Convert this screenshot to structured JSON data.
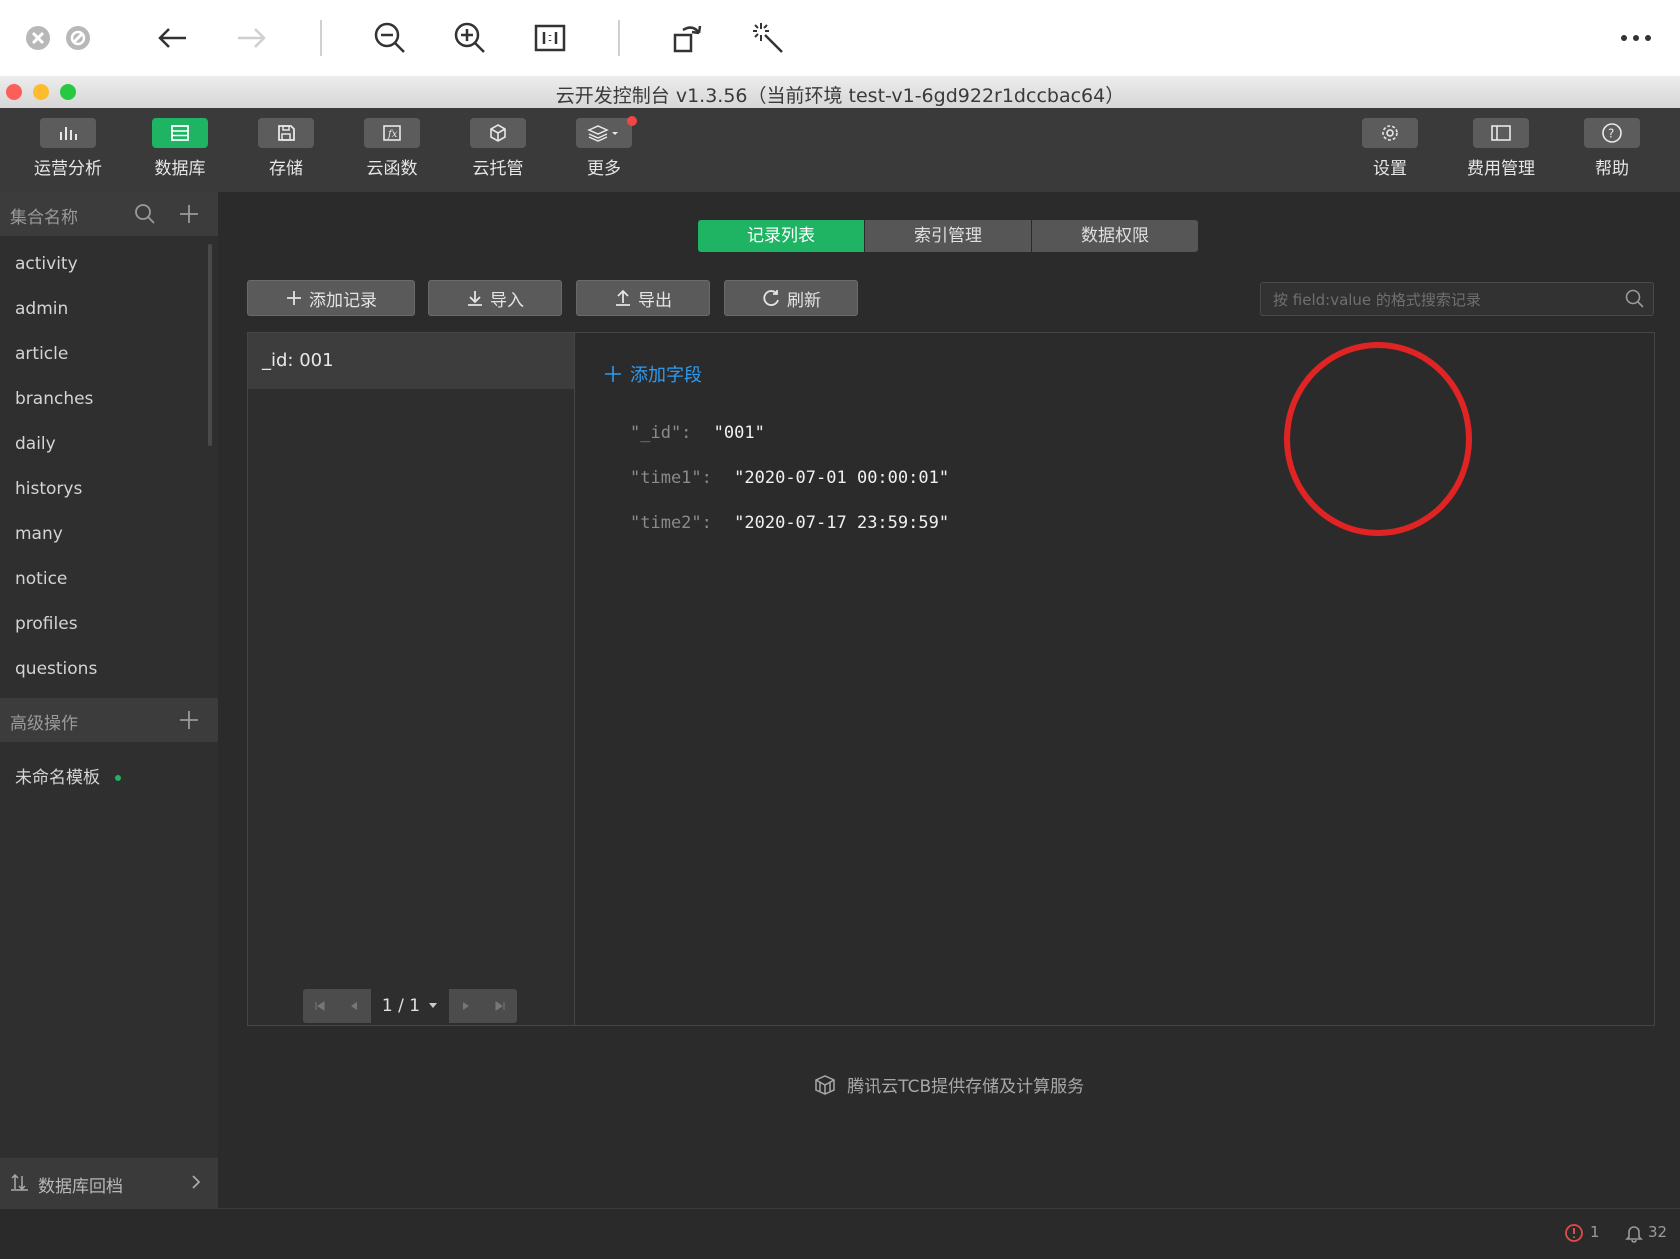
{
  "viewer": {
    "icons": [
      "close-icon",
      "close-icon",
      "back-arrow-icon",
      "forward-arrow-icon",
      "zoom-out-icon",
      "zoom-in-icon",
      "actual-size-icon",
      "rotate-icon",
      "magic-wand-icon",
      "more-icon"
    ]
  },
  "window": {
    "title": "云开发控制台 v1.3.56（当前环境 test-v1-6gd922r1dccbac64）"
  },
  "toolbar": {
    "left": [
      {
        "label": "运营分析",
        "icon": "bar-chart-icon"
      },
      {
        "label": "数据库",
        "icon": "database-icon",
        "active": true
      },
      {
        "label": "存储",
        "icon": "storage-icon"
      },
      {
        "label": "云函数",
        "icon": "function-icon"
      },
      {
        "label": "云托管",
        "icon": "cube-icon"
      },
      {
        "label": "更多",
        "icon": "layers-icon",
        "badge": true
      }
    ],
    "right": [
      {
        "label": "设置",
        "icon": "gear-icon"
      },
      {
        "label": "费用管理",
        "icon": "billing-icon"
      },
      {
        "label": "帮助",
        "icon": "help-icon"
      }
    ]
  },
  "sidebar": {
    "collections_header": "集合名称",
    "collections": [
      "activity",
      "admin",
      "article",
      "branches",
      "daily",
      "historys",
      "many",
      "notice",
      "profiles",
      "questions"
    ],
    "advanced_header": "高级操作",
    "templates": [
      "未命名模板"
    ],
    "rollback": "数据库回档"
  },
  "main": {
    "tabs": [
      {
        "label": "记录列表",
        "active": true
      },
      {
        "label": "索引管理"
      },
      {
        "label": "数据权限"
      }
    ],
    "actions": {
      "add_record": "添加记录",
      "import": "导入",
      "export": "导出",
      "refresh": "刷新"
    },
    "search_placeholder": "按 field:value 的格式搜索记录",
    "records": [
      "_id: 001"
    ],
    "add_field": "添加字段",
    "fields": [
      {
        "key": "\"_id\":",
        "value": "\"001\""
      },
      {
        "key": "\"time1\":",
        "value": "\"2020-07-01 00:00:01\""
      },
      {
        "key": "\"time2\":",
        "value": "\"2020-07-17 23:59:59\""
      }
    ],
    "pager": "1 / 1",
    "brand": "腾讯云TCB提供存储及计算服务"
  },
  "status": {
    "errors": "1",
    "notifications": "32"
  },
  "colors": {
    "accent": "#1fb464",
    "link": "#2f9bf0",
    "annotation": "#e02424"
  }
}
